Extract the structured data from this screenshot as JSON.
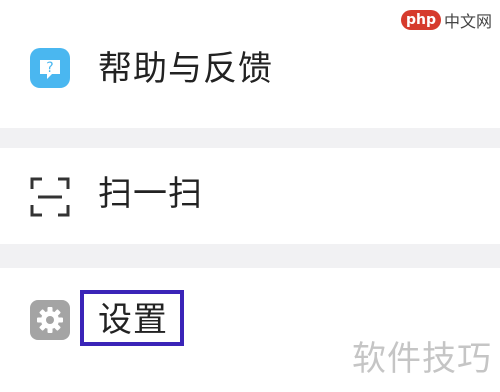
{
  "brand": {
    "logo_text": "php",
    "site_text": "中文网"
  },
  "menu": {
    "items": [
      {
        "label": "帮助与反馈",
        "icon": "help-feedback-icon",
        "icon_color": "#4ab7f0"
      },
      {
        "label": "扫一扫",
        "icon": "scan-icon",
        "icon_color": "#333333"
      },
      {
        "label": "设置",
        "icon": "gear-icon",
        "icon_color": "#a4a4a4"
      }
    ]
  },
  "annotation": {
    "highlight_color": "#3a24b8"
  },
  "watermark": {
    "text": "软件技巧"
  }
}
